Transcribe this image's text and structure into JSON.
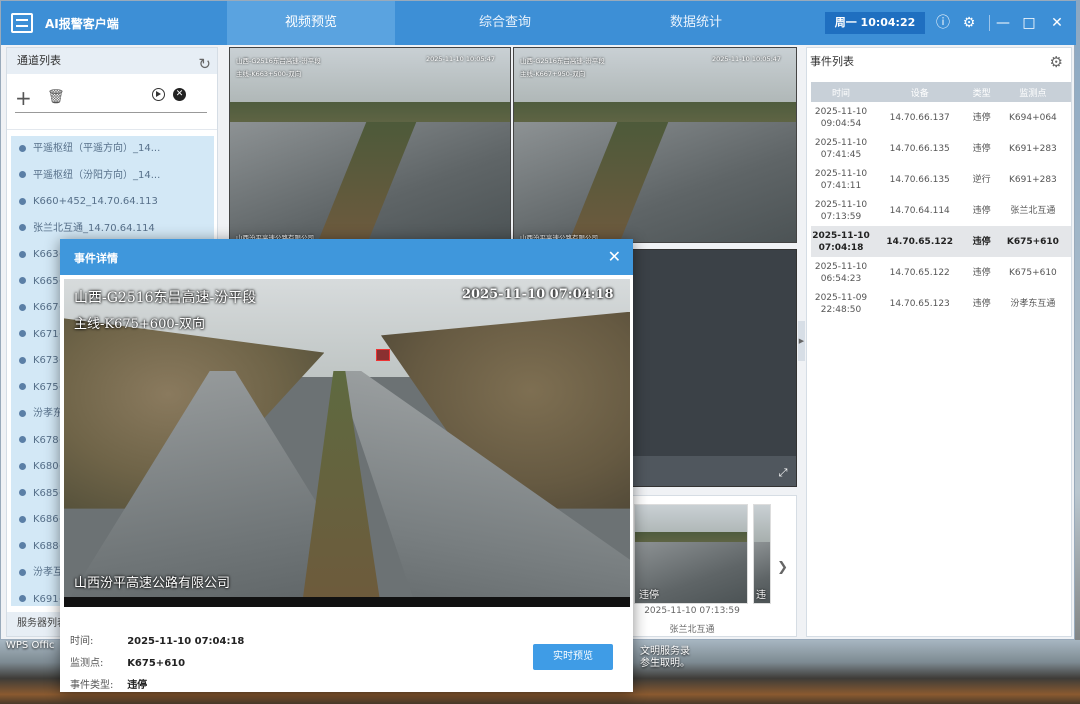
{
  "app": {
    "title": "AI报警客户端",
    "clock": "周一 10:04:22"
  },
  "nav": [
    {
      "label": "视频预览",
      "active": true
    },
    {
      "label": "综合查询",
      "active": false
    },
    {
      "label": "数据统计",
      "active": false
    }
  ],
  "left_panel": {
    "title": "通道列表",
    "channels": [
      "平遥枢纽（平遥方向）_14...",
      "平遥枢纽（汾阳方向）_14...",
      "K660+452_14.70.64.113",
      "张兰北互通_14.70.64.114",
      "K663+",
      "K665+",
      "K667+",
      "K671+",
      "K673+",
      "K675+",
      "汾孝东",
      "K678+",
      "K680+",
      "K685+",
      "K686+",
      "K688+",
      "汾孝互",
      "K691+"
    ],
    "footer": "服务器列表"
  },
  "videos": [
    {
      "osd_title": "山西-G2516东吕高速-汾平段",
      "osd_sub": "主线-K663+500-双向",
      "osd_time": "2025-11-10 10:05:47",
      "osd_company": "山西汾平高速公路有限公司"
    },
    {
      "osd_title": "山西-G2516东吕高速-汾平段",
      "osd_sub": "主线-K667+950-双向",
      "osd_time": "2025-11-10 10:05:47",
      "osd_company": "山西汾平高速公路有限公司"
    }
  ],
  "thumbnails": [
    {
      "label": "违停",
      "time": "2025-11-10 07:13:59",
      "place": "张兰北互通"
    },
    {
      "label": "违"
    }
  ],
  "right_panel": {
    "title": "事件列表",
    "columns": [
      "时间",
      "设备",
      "类型",
      "监测点"
    ],
    "rows": [
      {
        "time": "2025-11-10 09:04:54",
        "device": "14.70.66.137",
        "type": "违停",
        "point": "K694+064",
        "selected": false
      },
      {
        "time": "2025-11-10 07:41:45",
        "device": "14.70.66.135",
        "type": "违停",
        "point": "K691+283",
        "selected": false
      },
      {
        "time": "2025-11-10 07:41:11",
        "device": "14.70.66.135",
        "type": "逆行",
        "point": "K691+283",
        "selected": false
      },
      {
        "time": "2025-11-10 07:13:59",
        "device": "14.70.64.114",
        "type": "违停",
        "point": "张兰北互通",
        "selected": false
      },
      {
        "time": "2025-11-10 07:04:18",
        "device": "14.70.65.122",
        "type": "违停",
        "point": "K675+610",
        "selected": true
      },
      {
        "time": "2025-11-10 06:54:23",
        "device": "14.70.65.122",
        "type": "违停",
        "point": "K675+610",
        "selected": false
      },
      {
        "time": "2025-11-09 22:48:50",
        "device": "14.70.65.123",
        "type": "违停",
        "point": "汾孝东互通",
        "selected": false
      }
    ]
  },
  "modal": {
    "title": "事件详情",
    "osd_title": "山西-G2516东吕高速-汾平段",
    "osd_sub": "主线-K675+600-双向",
    "osd_time": "2025-11-10 07:04:18",
    "osd_company": "山西汾平高速公路有限公司",
    "time_label": "时间:",
    "time": "2025-11-10 07:04:18",
    "point_label": "监测点:",
    "point": "K675+610",
    "type_label": "事件类型:",
    "type": "违停",
    "live_button": "实时预览"
  },
  "desktop": {
    "wps_label": "WPS Offic",
    "note_line1": "文明服务录",
    "note_line2": "参生取明。"
  },
  "colors": {
    "accent": "#3d8fd6",
    "nav_active": "#5aa3e0",
    "clock_bg": "#1f6fc0",
    "button": "#3f9ce6"
  }
}
